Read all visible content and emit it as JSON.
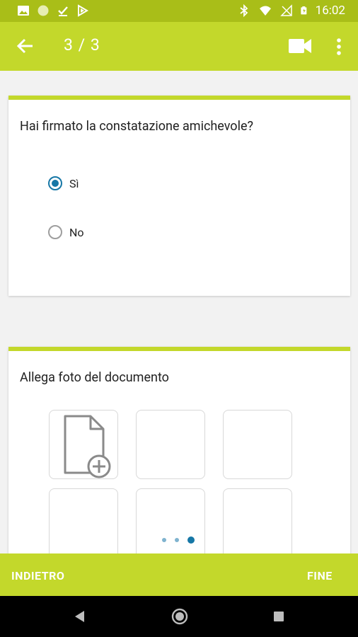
{
  "status_bar": {
    "time": "16:02",
    "left_icons": [
      "image-icon",
      "circle-icon",
      "download-check-icon",
      "play-store-icon"
    ],
    "right_icons": [
      "bluetooth-icon",
      "wifi-icon",
      "signal-off-icon",
      "battery-icon"
    ]
  },
  "app_bar": {
    "title": "3 / 3",
    "icons": [
      "back-arrow-icon",
      "video-camera-icon",
      "more-vert-icon"
    ]
  },
  "question1": {
    "text": "Hai firmato la constatazione amichevole?",
    "options": [
      {
        "label": "Sì",
        "selected": true
      },
      {
        "label": "No",
        "selected": false
      }
    ]
  },
  "question2": {
    "text": "Allega foto del documento",
    "tiles": [
      {
        "type": "add-document"
      },
      {
        "type": "empty"
      },
      {
        "type": "empty"
      },
      {
        "type": "empty"
      },
      {
        "type": "empty"
      },
      {
        "type": "empty"
      }
    ]
  },
  "pager": {
    "count": 3,
    "active_index": 2
  },
  "bottom_bar": {
    "back_label": "INDIETRO",
    "finish_label": "FINE"
  },
  "colors": {
    "accent": "#c3d82b",
    "status": "#a9be18",
    "radio": "#1677a6"
  }
}
